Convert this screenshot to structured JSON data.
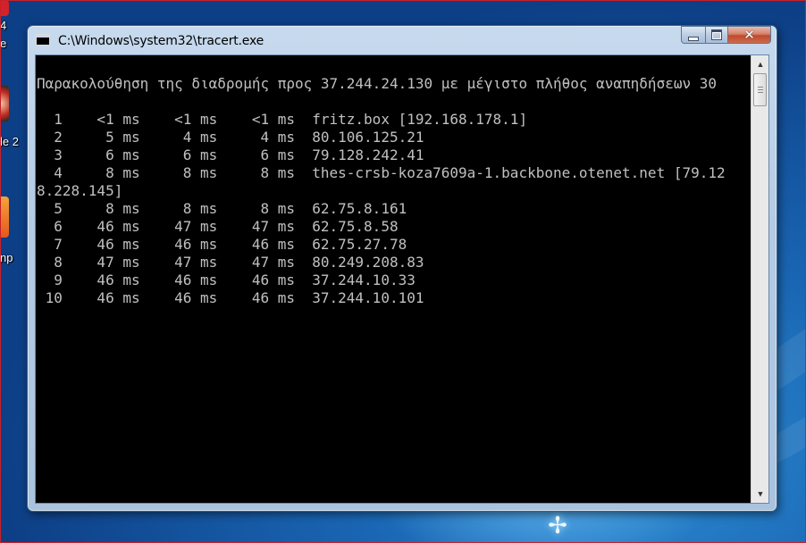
{
  "desktop": {
    "icon_labels": [
      "4",
      "e",
      "le 2",
      "np"
    ]
  },
  "window": {
    "title": "C:\\Windows\\system32\\tracert.exe",
    "icons": {
      "app": "console-icon",
      "minimize": "minimize-icon",
      "maximize": "maximize-icon",
      "close": "close-icon",
      "scroll_up": "scroll-up-arrow-icon",
      "scroll_down": "scroll-down-arrow-icon"
    }
  },
  "console": {
    "lines": [
      "Παρακολούθηση της διαδρομής προς 37.244.24.130 με μέγιστο πλήθος αναπηδήσεων 30",
      "",
      "  1    <1 ms    <1 ms    <1 ms  fritz.box [192.168.178.1]",
      "  2     5 ms     4 ms     4 ms  80.106.125.21",
      "  3     6 ms     6 ms     6 ms  79.128.242.41",
      "  4     8 ms     8 ms     8 ms  thes-crsb-koza7609a-1.backbone.otenet.net [79.12",
      "8.228.145]",
      "  5     8 ms     8 ms     8 ms  62.75.8.161",
      "  6    46 ms    47 ms    47 ms  62.75.8.58",
      "  7    46 ms    46 ms    46 ms  62.75.27.78",
      "  8    47 ms    47 ms    47 ms  80.249.208.83",
      "  9    46 ms    46 ms    46 ms  37.244.10.33",
      " 10    46 ms    46 ms    46 ms  37.244.10.101"
    ]
  },
  "colors": {
    "console_bg": "#000000",
    "console_fg": "#c0c0c0",
    "desktop_blue": "#1a66b4",
    "close_red": "#c0492c"
  }
}
